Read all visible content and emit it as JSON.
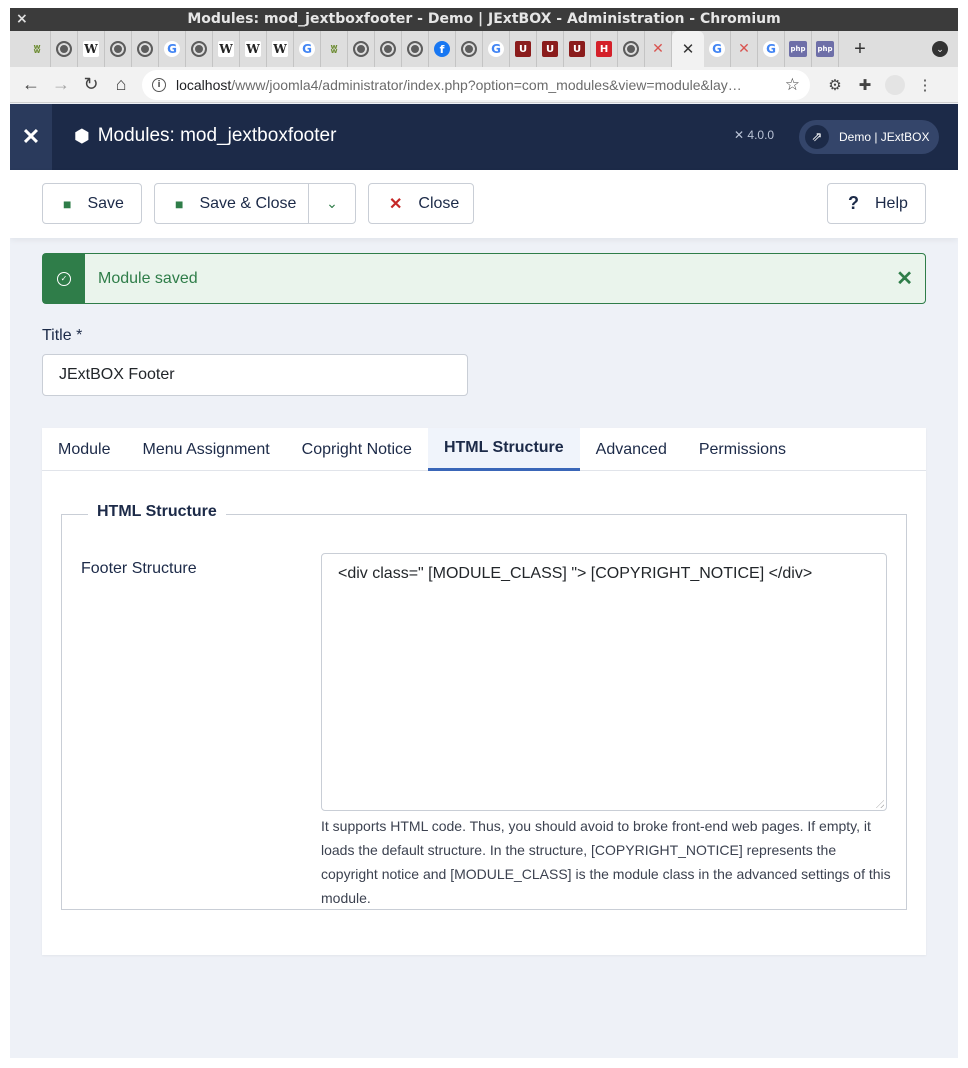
{
  "browser": {
    "window_title": "Modules: mod_jextboxfooter - Demo | JExtBOX - Administration - Chromium",
    "close_glyph": "×",
    "tabs": [
      {
        "icon": "bio-icon",
        "glyph": "ʬ"
      },
      {
        "icon": "globe-icon",
        "glyph": ""
      },
      {
        "icon": "wikipedia-icon",
        "glyph": "W"
      },
      {
        "icon": "globe-icon",
        "glyph": ""
      },
      {
        "icon": "globe-icon",
        "glyph": ""
      },
      {
        "icon": "google-icon",
        "glyph": "G"
      },
      {
        "icon": "globe-icon",
        "glyph": ""
      },
      {
        "icon": "wikipedia-icon",
        "glyph": "W"
      },
      {
        "icon": "wikipedia-icon",
        "glyph": "W"
      },
      {
        "icon": "wikipedia-icon",
        "glyph": "W"
      },
      {
        "icon": "google-icon",
        "glyph": "G"
      },
      {
        "icon": "bio-icon",
        "glyph": "ʬ"
      },
      {
        "icon": "globe-icon",
        "glyph": ""
      },
      {
        "icon": "globe-icon",
        "glyph": ""
      },
      {
        "icon": "globe-icon",
        "glyph": ""
      },
      {
        "icon": "facebook-icon",
        "glyph": "f"
      },
      {
        "icon": "globe-icon",
        "glyph": ""
      },
      {
        "icon": "google-icon",
        "glyph": "G"
      },
      {
        "icon": "u-icon",
        "glyph": "U"
      },
      {
        "icon": "u-icon",
        "glyph": "U"
      },
      {
        "icon": "u-icon",
        "glyph": "U"
      },
      {
        "icon": "h-icon",
        "glyph": "H"
      },
      {
        "icon": "globe-icon",
        "glyph": ""
      },
      {
        "icon": "joomla-icon",
        "glyph": "✕"
      }
    ],
    "active_tab_close": "✕",
    "tabs_after": [
      {
        "icon": "google-icon",
        "glyph": "G"
      },
      {
        "icon": "joomla-icon",
        "glyph": "✕"
      },
      {
        "icon": "google-icon",
        "glyph": "G"
      },
      {
        "icon": "php-icon",
        "glyph": "php"
      },
      {
        "icon": "php-icon",
        "glyph": "php"
      }
    ],
    "new_tab": "+",
    "url_host": "localhost",
    "url_path": "/www/joomla4/administrator/index.php?option=com_modules&view=module&lay…"
  },
  "header": {
    "title": "Modules: mod_jextboxfooter",
    "version": "4.0.0",
    "site_link": "Demo | JExtBOX"
  },
  "toolbar": {
    "save": "Save",
    "save_close": "Save & Close",
    "close": "Close",
    "help": "Help"
  },
  "alert": {
    "message": "Module saved"
  },
  "form": {
    "title_label": "Title *",
    "title_value": "JExtBOX Footer"
  },
  "tabs": [
    "Module",
    "Menu Assignment",
    "Copright Notice",
    "HTML Structure",
    "Advanced",
    "Permissions"
  ],
  "active_tab": "HTML Structure",
  "panel": {
    "legend": "HTML Structure",
    "field_label": "Footer Structure",
    "field_value": "<div class=\" [MODULE_CLASS] \"> [COPYRIGHT_NOTICE] </div>",
    "hint": "It supports HTML code. Thus, you should avoid to broke front-end web pages. If empty, it loads the default structure. In the structure, [COPYRIGHT_NOTICE] represents the copyright notice and [MODULE_CLASS] is the module class in the advanced settings of this module."
  },
  "colors": {
    "header_bg": "#1c2a48",
    "success": "#2f7d49",
    "danger": "#c52827",
    "tab_active": "#3a66b8"
  }
}
